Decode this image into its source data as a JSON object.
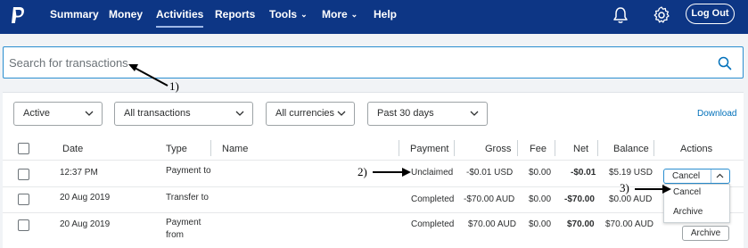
{
  "nav": {
    "items": [
      {
        "label": "Summary"
      },
      {
        "label": "Money"
      },
      {
        "label": "Activities"
      },
      {
        "label": "Reports"
      },
      {
        "label": "Tools"
      },
      {
        "label": "More"
      },
      {
        "label": "Help"
      }
    ],
    "active": "Activities",
    "logout_label": "Log Out",
    "icons": [
      "paypal-logo",
      "bell-icon",
      "gear-icon"
    ]
  },
  "search": {
    "placeholder": "Search for transactions"
  },
  "annotations": {
    "a1": "1)",
    "a2": "2)",
    "a3": "3)"
  },
  "filters": {
    "status": "Active",
    "type": "All transactions",
    "currency": "All currencies",
    "period": "Past 30 days",
    "download_label": "Download"
  },
  "table": {
    "headers": [
      "Date",
      "Type",
      "Name",
      "Payment",
      "Gross",
      "Fee",
      "Net",
      "Balance",
      "Actions"
    ],
    "rows": [
      {
        "date": "12:37 PM",
        "type": "Payment to",
        "type2": "",
        "name": "",
        "payment": "Unclaimed",
        "gross": "-$0.01 USD",
        "fee": "$0.00",
        "net": "-$0.01",
        "balance": "$5.19 USD"
      },
      {
        "date": "20 Aug 2019",
        "type": "Transfer to",
        "type2": "",
        "name": "",
        "payment": "Completed",
        "gross": "-$70.00 AUD",
        "fee": "$0.00",
        "net": "-$70.00",
        "balance": "$0.00 AUD"
      },
      {
        "date": "20 Aug 2019",
        "type": "Payment",
        "type2": "from",
        "name": "",
        "payment": "Completed",
        "gross": "$70.00 AUD",
        "fee": "$0.00",
        "net": "$70.00",
        "balance": "$70.00 AUD"
      }
    ]
  },
  "actions": {
    "cancel_label": "Cancel",
    "menu": [
      "Cancel",
      "Archive"
    ],
    "archive_label": "Archive"
  },
  "colors": {
    "nav_bg": "#0d3685",
    "accent": "#0070ba",
    "focus_border": "#2a8ed0"
  }
}
